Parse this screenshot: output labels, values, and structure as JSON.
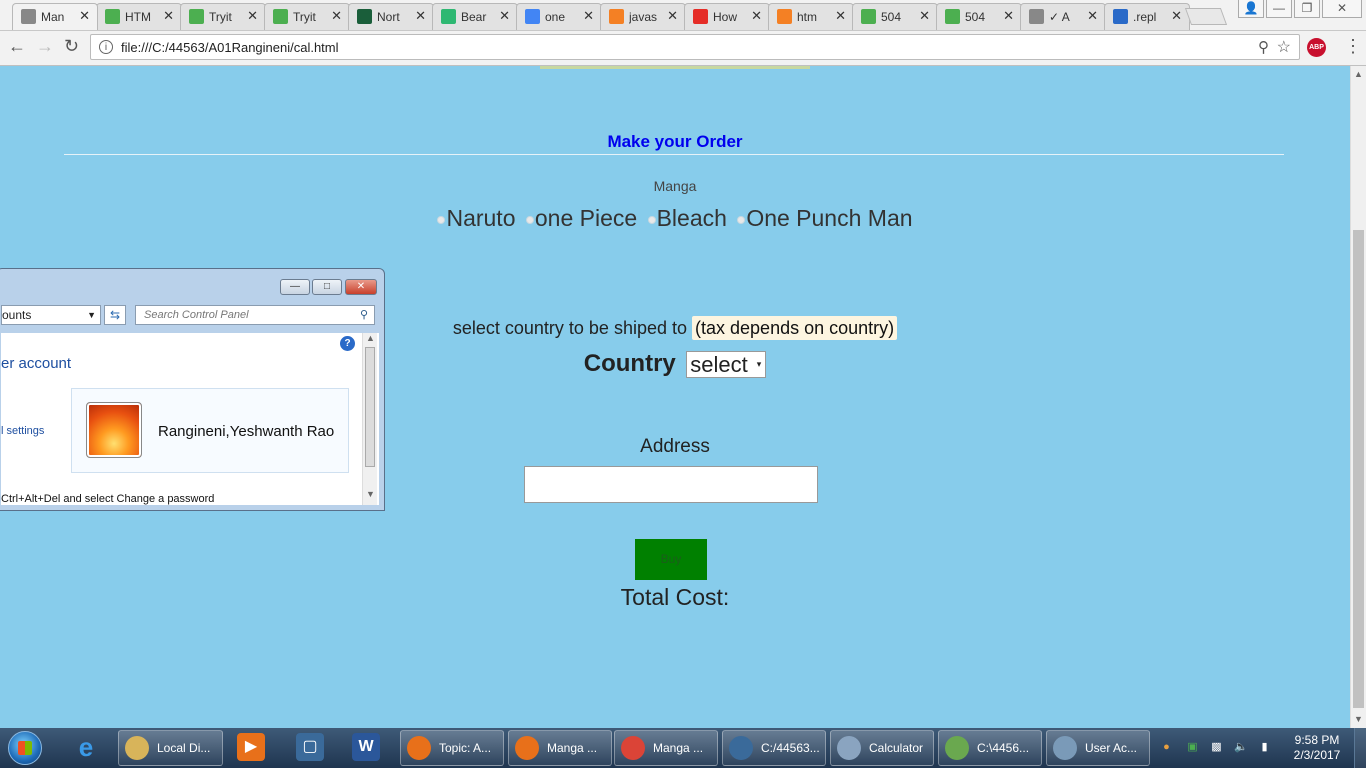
{
  "browser": {
    "tabs": [
      {
        "title": "Man",
        "favicon": "page-icon",
        "fav_color": "#888888",
        "active": true
      },
      {
        "title": "HTM",
        "favicon": "w3schools-icon",
        "fav_color": "#4caf50"
      },
      {
        "title": "Tryit",
        "favicon": "w3schools-icon",
        "fav_color": "#4caf50"
      },
      {
        "title": "Tryit",
        "favicon": "w3schools-icon",
        "fav_color": "#4caf50"
      },
      {
        "title": "Nort",
        "favicon": "n-icon",
        "fav_color": "#1a5e3a"
      },
      {
        "title": "Bear",
        "favicon": "check-icon",
        "fav_color": "#2eb872"
      },
      {
        "title": "one",
        "favicon": "google-icon",
        "fav_color": "#4285f4"
      },
      {
        "title": "javas",
        "favicon": "stackoverflow-icon",
        "fav_color": "#f48024"
      },
      {
        "title": "How",
        "favicon": "youtube-icon",
        "fav_color": "#e52d27"
      },
      {
        "title": "htm",
        "favicon": "stackoverflow-icon",
        "fav_color": "#f48024"
      },
      {
        "title": "504",
        "favicon": "w3schools-icon",
        "fav_color": "#4caf50"
      },
      {
        "title": "504",
        "favicon": "w3schools-icon",
        "fav_color": "#4caf50"
      },
      {
        "title": "✓ A",
        "favicon": "page-icon",
        "fav_color": "#888888"
      },
      {
        "title": ".repl",
        "favicon": "jquery-icon",
        "fav_color": "#2a6ac8"
      }
    ],
    "url": "file:///C:/44563/A01Rangineni/cal.html",
    "abp_label": "ABP"
  },
  "page": {
    "title": "Make your Order",
    "manga_label": "Manga",
    "manga_options": [
      "Naruto",
      "one Piece",
      "Bleach",
      "One Punch Man"
    ],
    "country_prompt": "select country to be shiped to",
    "tax_note": "(tax depends on country)",
    "country_label": "Country",
    "country_select": "select",
    "address_label": "Address",
    "address_value": "",
    "buy_label": "Buy",
    "total_cost_label": "Total Cost:"
  },
  "control_panel": {
    "address_text": "ounts",
    "search_placeholder": "Search Control Panel",
    "heading": "er account",
    "side_link": "l settings",
    "user_name": "Rangineni,Yeshwanth Rao",
    "tail_text": "Ctrl+Alt+Del and select Change a password"
  },
  "taskbar": {
    "buttons": [
      {
        "label": "Local Di...",
        "icon": "folder-icon",
        "color": "#d8b45a"
      },
      {
        "label": "Topic: A...",
        "icon": "firefox-icon",
        "color": "#e8701a"
      },
      {
        "label": "Manga ...",
        "icon": "firefox-icon",
        "color": "#e8701a"
      },
      {
        "label": "Manga ...",
        "icon": "chrome-icon",
        "color": "#db4437"
      },
      {
        "label": "C:/44563...",
        "icon": "brackets-icon",
        "color": "#3a6a9a"
      },
      {
        "label": "Calculator",
        "icon": "calculator-icon",
        "color": "#8aa4c0"
      },
      {
        "label": "C:\\4456...",
        "icon": "notepadpp-icon",
        "color": "#6aa84f"
      },
      {
        "label": "User Ac...",
        "icon": "users-icon",
        "color": "#7a9ab8"
      }
    ],
    "time": "9:58 PM",
    "date": "2/3/2017"
  }
}
